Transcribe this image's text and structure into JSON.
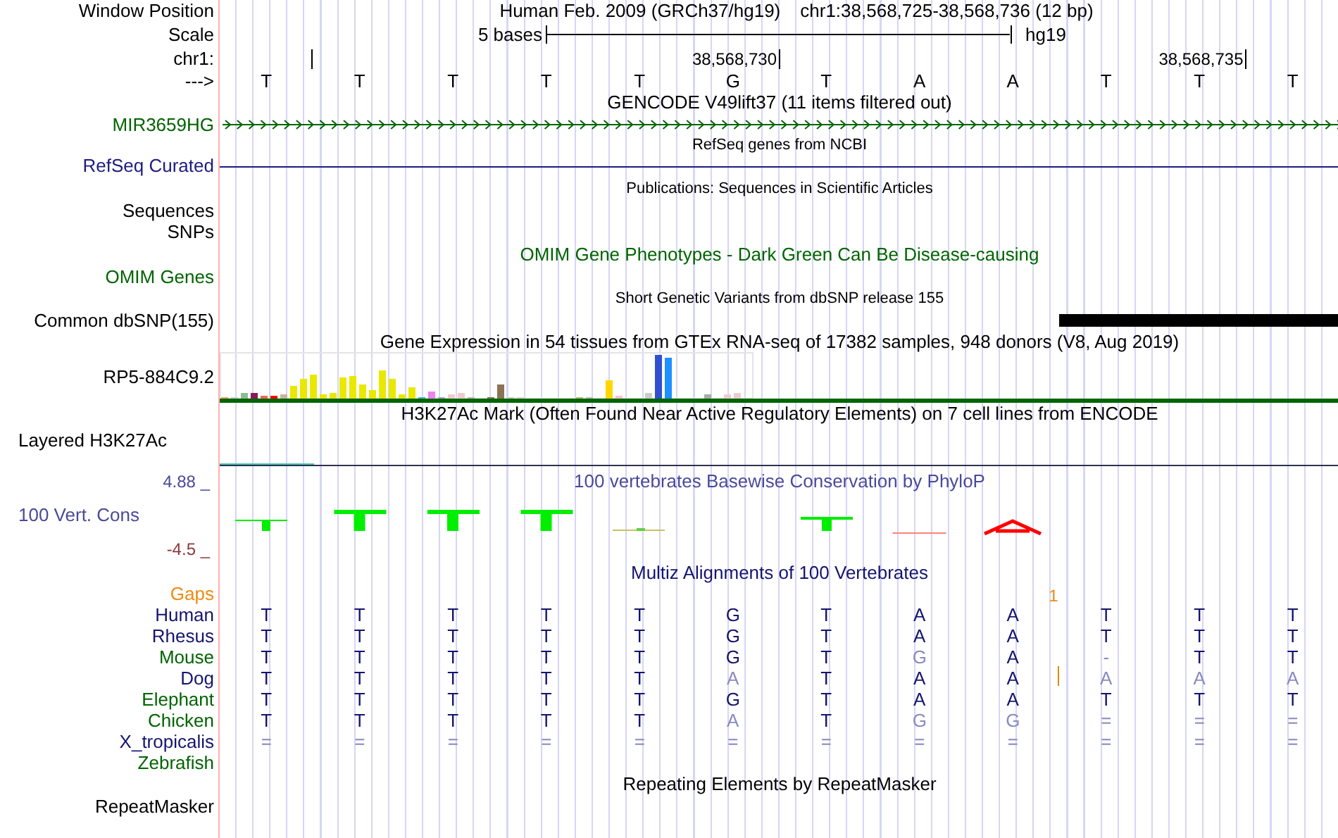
{
  "header": {
    "window_position_label": "Window Position",
    "assembly": "Human Feb. 2009 (GRCh37/hg19)",
    "position": "chr1:38,568,725-38,568,736 (12 bp)",
    "scale_label": "Scale",
    "scale_text": "5 bases",
    "scale_db": "hg19",
    "chrom_label": "chr1:",
    "ticks": [
      {
        "label": "38,568,730"
      },
      {
        "label": "38,568,735"
      }
    ],
    "strand_label": "--->",
    "bases": [
      "T",
      "T",
      "T",
      "T",
      "T",
      "G",
      "T",
      "A",
      "A",
      "T",
      "T",
      "T"
    ]
  },
  "tracks": [
    {
      "kind": "arrows",
      "title": {
        "text": "GENCODE V49lift37 (11 items filtered out)",
        "color": "#000000"
      },
      "compact": false,
      "label": "MIR3659HG",
      "color": "#006400"
    },
    {
      "kind": "line",
      "title": {
        "text": "RefSeq genes from NCBI",
        "color": "#000000"
      },
      "compact": true,
      "label": "RefSeq Curated",
      "color": "#1c1c80"
    },
    {
      "kind": "labels",
      "title": {
        "text": "Publications: Sequences in Scientific Articles",
        "color": "#000000"
      },
      "compact": true,
      "labels": [
        "Sequences",
        "SNPs"
      ],
      "color": "#000000"
    },
    {
      "kind": "empty",
      "title": {
        "text": "OMIM Gene Phenotypes - Dark Green Can Be Disease-causing",
        "color": "#006400"
      },
      "compact": false,
      "label": "OMIM Genes",
      "color": "#006400"
    },
    {
      "kind": "bar",
      "title": {
        "text": "Short Genetic Variants from dbSNP release 155",
        "color": "#000000"
      },
      "compact": true,
      "label": "Common dbSNP(155)",
      "color": "#000000"
    },
    {
      "kind": "expression",
      "title": {
        "text": "Gene Expression in 54 tissues from GTEx RNA-seq of 17382 samples, 948 donors (V8, Aug 2019)",
        "color": "#000000"
      },
      "compact": false,
      "label": "RP5-884C9.2",
      "color": "#000000"
    },
    {
      "kind": "layered",
      "title": {
        "text": "H3K27Ac Mark (Often Found Near Active Regulatory Elements) on 7 cell lines from ENCODE",
        "color": "#000000"
      },
      "compact": false,
      "label": "Layered H3K27Ac",
      "color": "#000000"
    },
    {
      "kind": "wiggle",
      "title": {
        "text": "100 vertebrates Basewise Conservation by PhyloP",
        "color": "#4a4a9a"
      },
      "compact": false,
      "label": "100 Vert. Cons",
      "color": "#4a4a9a",
      "axis_max": "4.88 _",
      "axis_min": "-4.5 _"
    },
    {
      "kind": "alignment",
      "title": {
        "text": "Multiz Alignments of 100 Vertebrates",
        "color": "#14146e"
      },
      "compact": false,
      "gaps_label": "Gaps",
      "gaps_count": "1",
      "species": [
        {
          "name": "Human",
          "color": "#14146e",
          "insertion": false,
          "bases": [
            {
              "base": "T",
              "match": true
            },
            {
              "base": "T",
              "match": true
            },
            {
              "base": "T",
              "match": true
            },
            {
              "base": "T",
              "match": true
            },
            {
              "base": "T",
              "match": true
            },
            {
              "base": "G",
              "match": true
            },
            {
              "base": "T",
              "match": true
            },
            {
              "base": "A",
              "match": true
            },
            {
              "base": "A",
              "match": true
            },
            {
              "base": "T",
              "match": true
            },
            {
              "base": "T",
              "match": true
            },
            {
              "base": "T",
              "match": true
            }
          ]
        },
        {
          "name": "Rhesus",
          "color": "#14146e",
          "insertion": false,
          "bases": [
            {
              "base": "T",
              "match": true
            },
            {
              "base": "T",
              "match": true
            },
            {
              "base": "T",
              "match": true
            },
            {
              "base": "T",
              "match": true
            },
            {
              "base": "T",
              "match": true
            },
            {
              "base": "G",
              "match": true
            },
            {
              "base": "T",
              "match": true
            },
            {
              "base": "A",
              "match": true
            },
            {
              "base": "A",
              "match": true
            },
            {
              "base": "T",
              "match": true
            },
            {
              "base": "T",
              "match": true
            },
            {
              "base": "T",
              "match": true
            }
          ]
        },
        {
          "name": "Mouse",
          "color": "#006400",
          "insertion": false,
          "bases": [
            {
              "base": "T",
              "match": true
            },
            {
              "base": "T",
              "match": true
            },
            {
              "base": "T",
              "match": true
            },
            {
              "base": "T",
              "match": true
            },
            {
              "base": "T",
              "match": true
            },
            {
              "base": "G",
              "match": true
            },
            {
              "base": "T",
              "match": true
            },
            {
              "base": "G",
              "match": false
            },
            {
              "base": "A",
              "match": true
            },
            {
              "base": "-",
              "match": false
            },
            {
              "base": "T",
              "match": true
            },
            {
              "base": "T",
              "match": true
            }
          ]
        },
        {
          "name": "Dog",
          "color": "#14146e",
          "insertion": true,
          "bases": [
            {
              "base": "T",
              "match": true
            },
            {
              "base": "T",
              "match": true
            },
            {
              "base": "T",
              "match": true
            },
            {
              "base": "T",
              "match": true
            },
            {
              "base": "T",
              "match": true
            },
            {
              "base": "A",
              "match": false
            },
            {
              "base": "T",
              "match": true
            },
            {
              "base": "A",
              "match": true
            },
            {
              "base": "A",
              "match": true
            },
            {
              "base": "A",
              "match": false
            },
            {
              "base": "A",
              "match": false
            },
            {
              "base": "A",
              "match": false
            }
          ]
        },
        {
          "name": "Elephant",
          "color": "#006400",
          "insertion": false,
          "bases": [
            {
              "base": "T",
              "match": true
            },
            {
              "base": "T",
              "match": true
            },
            {
              "base": "T",
              "match": true
            },
            {
              "base": "T",
              "match": true
            },
            {
              "base": "T",
              "match": true
            },
            {
              "base": "G",
              "match": true
            },
            {
              "base": "T",
              "match": true
            },
            {
              "base": "A",
              "match": true
            },
            {
              "base": "A",
              "match": true
            },
            {
              "base": "T",
              "match": true
            },
            {
              "base": "T",
              "match": true
            },
            {
              "base": "T",
              "match": true
            }
          ]
        },
        {
          "name": "Chicken",
          "color": "#006400",
          "insertion": false,
          "bases": [
            {
              "base": "T",
              "match": true
            },
            {
              "base": "T",
              "match": true
            },
            {
              "base": "T",
              "match": true
            },
            {
              "base": "T",
              "match": true
            },
            {
              "base": "T",
              "match": true
            },
            {
              "base": "A",
              "match": false
            },
            {
              "base": "T",
              "match": true
            },
            {
              "base": "G",
              "match": false
            },
            {
              "base": "G",
              "match": false
            },
            {
              "base": "=",
              "match": false
            },
            {
              "base": "=",
              "match": false
            },
            {
              "base": "=",
              "match": false
            }
          ]
        },
        {
          "name": "X_tropicalis",
          "color": "#14146e",
          "insertion": false,
          "bases": [
            {
              "base": "=",
              "match": false
            },
            {
              "base": "=",
              "match": false
            },
            {
              "base": "=",
              "match": false
            },
            {
              "base": "=",
              "match": false
            },
            {
              "base": "=",
              "match": false
            },
            {
              "base": "=",
              "match": false
            },
            {
              "base": "=",
              "match": false
            },
            {
              "base": "=",
              "match": false
            },
            {
              "base": "=",
              "match": false
            },
            {
              "base": "=",
              "match": false
            },
            {
              "base": "=",
              "match": false
            },
            {
              "base": "=",
              "match": false
            }
          ]
        },
        {
          "name": "Zebrafish",
          "color": "#006400",
          "insertion": false
        }
      ]
    },
    {
      "kind": "empty",
      "title": {
        "text": "Repeating Elements by RepeatMasker",
        "color": "#000000"
      },
      "compact": false,
      "label": "RepeatMasker",
      "color": "#000000"
    }
  ]
}
